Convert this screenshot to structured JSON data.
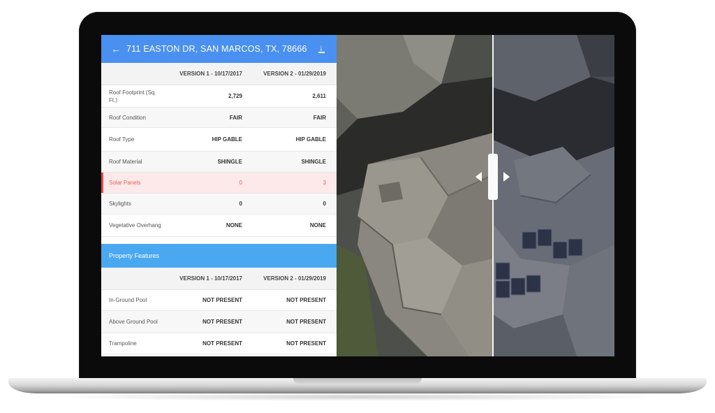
{
  "header": {
    "back_icon": "back-arrow-icon",
    "address": "711 EASTON DR, SAN MARCOS, TX, 78666",
    "download_icon": "download-icon"
  },
  "roof": {
    "columns": [
      "",
      "VERSION 1 - 10/17/2017",
      "VERSION 2 - 01/29/2019"
    ],
    "rows": [
      {
        "label": "Roof Footprint (Sq. Ft.)",
        "v1": "2,729",
        "v2": "2,611"
      },
      {
        "label": "Roof Condition",
        "v1": "FAIR",
        "v2": "FAIR"
      },
      {
        "label": "Roof Type",
        "v1": "HIP GABLE",
        "v2": "HIP GABLE"
      },
      {
        "label": "Roof Material",
        "v1": "SHINGLE",
        "v2": "SHINGLE"
      },
      {
        "label": "Solar Panels",
        "v1": "0",
        "v2": "3"
      },
      {
        "label": "Skylights",
        "v1": "0",
        "v2": "0"
      },
      {
        "label": "Vegetative Overhang",
        "v1": "NONE",
        "v2": "NONE"
      }
    ]
  },
  "features": {
    "title": "Property Features",
    "columns": [
      "",
      "VERSION 1 - 10/17/2017",
      "VERSION 2 - 01/29/2019"
    ],
    "rows": [
      {
        "label": "In-Ground Pool",
        "v1": "NOT PRESENT",
        "v2": "NOT PRESENT"
      },
      {
        "label": "Above Ground Pool",
        "v1": "NOT PRESENT",
        "v2": "NOT PRESENT"
      },
      {
        "label": "Trampoline",
        "v1": "NOT PRESENT",
        "v2": "NOT PRESENT"
      }
    ]
  },
  "imagery": {
    "left_image": "aerial-roof-2017",
    "right_image": "aerial-roof-2019-with-solar-panels",
    "slider_icon": "compare-slider-icon"
  },
  "colors": {
    "header": "#4a90f0",
    "section": "#4aa8f0",
    "highlight_bg": "#fde9e9",
    "highlight_text": "#e06060"
  }
}
